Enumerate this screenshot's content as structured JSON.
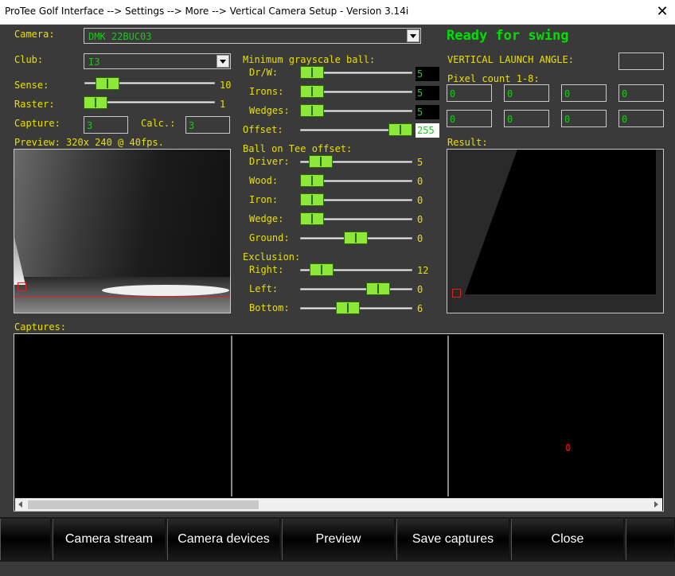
{
  "window": {
    "title": "ProTee Golf Interface --> Settings --> More --> Vertical Camera Setup  - Version 3.14i",
    "close_glyph": "✕"
  },
  "camera": {
    "label": "Camera:",
    "value": "DMK 22BUC03"
  },
  "club": {
    "label": "Club:",
    "value": "I3"
  },
  "sense": {
    "label": "Sense:",
    "value": "10"
  },
  "raster": {
    "label": "Raster:",
    "value": "1"
  },
  "capture": {
    "label": "Capture:",
    "value": "3"
  },
  "calc": {
    "label": "Calc.:",
    "value": "3"
  },
  "preview": {
    "label": "Preview: 320x 240 @ 40fps."
  },
  "min_gray": {
    "title": "Minimum grayscale ball:",
    "drw": {
      "label": "Dr/W:",
      "value": "5"
    },
    "irons": {
      "label": "Irons:",
      "value": "5"
    },
    "wedges": {
      "label": "Wedges:",
      "value": "5"
    },
    "offset": {
      "label": "Offset:",
      "value": "255"
    }
  },
  "tee_offset": {
    "title": "Ball on Tee offset:",
    "driver": {
      "label": "Driver:",
      "value": "5"
    },
    "wood": {
      "label": "Wood:",
      "value": "0"
    },
    "iron": {
      "label": "Iron:",
      "value": "0"
    },
    "wedge": {
      "label": "Wedge:",
      "value": "0"
    },
    "ground": {
      "label": "Ground:",
      "value": "0"
    }
  },
  "exclusion": {
    "title": "Exclusion:",
    "right": {
      "label": "Right:",
      "value": "12"
    },
    "left": {
      "label": "Left:",
      "value": "0"
    },
    "bottom": {
      "label": "Bottom:",
      "value": "6"
    }
  },
  "status": "Ready for swing",
  "vla": {
    "label": "VERTICAL LAUNCH ANGLE:",
    "value": ""
  },
  "pixel_count": {
    "label": "Pixel count 1-8:",
    "values": [
      "0",
      "0",
      "0",
      "0",
      "0",
      "0",
      "0",
      "0"
    ]
  },
  "result": {
    "label": "Result:"
  },
  "captures": {
    "label": "Captures:",
    "marker": "0"
  },
  "buttons": {
    "camera_stream": "Camera stream",
    "camera_devices": "Camera devices",
    "preview": "Preview",
    "save_captures": "Save captures",
    "close": "Close"
  },
  "colors": {
    "label_yellow": "#e8e000",
    "value_green": "#19c819",
    "status_green": "#00e000",
    "thumb_green": "#8ee83a"
  }
}
